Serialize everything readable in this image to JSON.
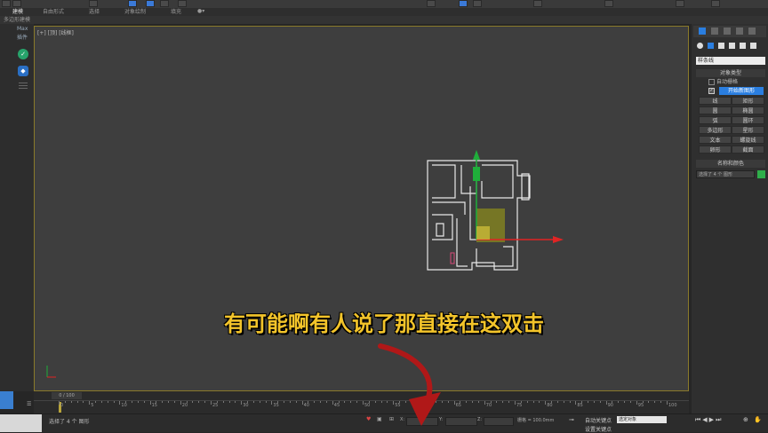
{
  "ribbon": {
    "tabs": [
      "建模",
      "自由形式",
      "选择",
      "对象绘制",
      "填充"
    ]
  },
  "subbar": {
    "label": "多边形建模"
  },
  "left_strip": {
    "top_label": "Max",
    "sub_label": "插件"
  },
  "viewport": {
    "label": "[+] [顶] [线框]"
  },
  "right_panel": {
    "dropdown": "样条线",
    "rollout1_title": "对象类型",
    "auto_grid": "自动栅格",
    "start_new_shape": "开始新图形",
    "buttons": [
      "线",
      "矩形",
      "圆",
      "椭圆",
      "弧",
      "圆环",
      "多边形",
      "星形",
      "文本",
      "螺旋线",
      "卵形",
      "截面"
    ],
    "rollout2_title": "名称和颜色",
    "name_value": "选择了 4 个 图形"
  },
  "timeline": {
    "frame_label": "0 / 100",
    "ticks": [
      "0",
      "5",
      "10",
      "15",
      "20",
      "25",
      "30",
      "35",
      "40",
      "45",
      "50",
      "55",
      "60",
      "65",
      "70",
      "75",
      "80",
      "85",
      "90",
      "95",
      "100"
    ]
  },
  "status": {
    "selection": "选择了 4 个 图形",
    "grid": "栅格 = 100.0mm",
    "auto_key": "自动关键点",
    "selected_objects": "选定对象",
    "set_key": "设置关键点",
    "x_label": "X:",
    "y_label": "Y:",
    "z_label": "Z:"
  },
  "subtitle": {
    "text": "有可能啊有人说了那直接在这双击"
  },
  "colors": {
    "viewport_bg": "#3e3e3e",
    "subtitle": "#f3c42a",
    "axis_red": "#e02424",
    "axis_green": "#1fae3a",
    "arrow": "#b01818",
    "accent_blue": "#3b7ad8"
  }
}
